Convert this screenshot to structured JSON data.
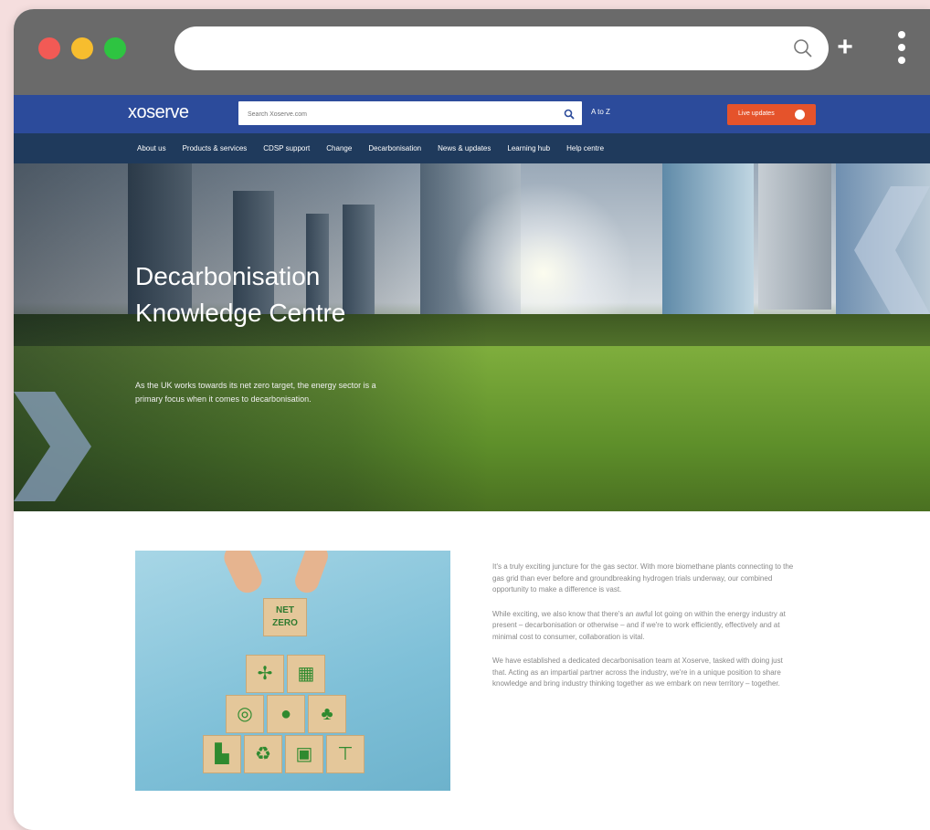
{
  "browser": {
    "url_value": "",
    "icons": [
      "search-icon",
      "plus-icon",
      "kebab-menu-icon"
    ]
  },
  "site": {
    "logo": "xoserve",
    "search_placeholder": "Search Xoserve.com",
    "atoz_label": "A to Z",
    "live_updates_label": "Live updates",
    "nav": [
      "About us",
      "Products & services",
      "CDSP support",
      "Change",
      "Decarbonisation",
      "News & updates",
      "Learning hub",
      "Help centre"
    ],
    "colors": {
      "header": "#2c4b9b",
      "nav": "#1f3a5c",
      "accent": "#e5532b"
    }
  },
  "hero": {
    "title": "Decarbonisation Knowledge Centre",
    "subtitle": "As the UK works towards its net zero target, the energy sector is a primary focus when it comes to decarbonisation."
  },
  "content": {
    "image_label": "NET ZERO",
    "paragraphs": [
      "It's a truly exciting juncture for the gas sector. With more biomethane plants connecting to the gas grid than ever before and groundbreaking hydrogen trials underway, our combined opportunity to make a difference is vast.",
      "While exciting, we also know that there's an awful lot going on within the energy industry at present – decarbonisation or otherwise – and if we're to work efficiently, effectively and at minimal cost to consumer, collaboration is vital.",
      "We have established a dedicated decarbonisation team at Xoserve, tasked with doing just that. Acting as an impartial partner across the industry, we're in a unique position to share knowledge and bring industry thinking together as we embark on new territory – together."
    ]
  }
}
